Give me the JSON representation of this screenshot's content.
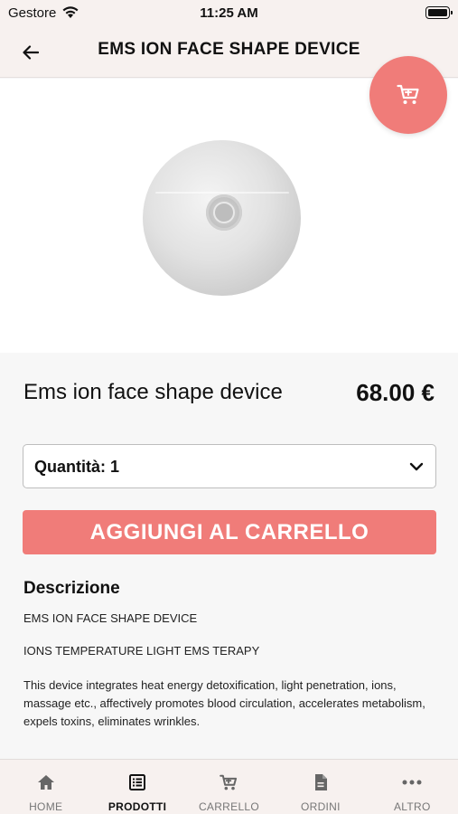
{
  "status_bar": {
    "carrier": "Gestore",
    "time": "11:25 AM"
  },
  "nav": {
    "title": "EMS ION FACE SHAPE DEVICE"
  },
  "product": {
    "name": "Ems ion face shape device",
    "price": "68.00 €"
  },
  "quantity": {
    "label": "Quantità: 1"
  },
  "add_to_cart": {
    "label": "AGGIUNGI AL CARRELLO"
  },
  "description": {
    "heading": "Descrizione",
    "line1": "EMS ION FACE SHAPE DEVICE",
    "line2": "IONS TEMPERATURE LIGHT EMS TERAPY",
    "paragraph": "This device integrates heat energy detoxification, light penetration, ions, massage etc., affectively promotes blood circulation, accelerates metabolism, expels toxins, eliminates wrinkles."
  },
  "tabs": [
    {
      "label": "HOME",
      "icon": "home-icon"
    },
    {
      "label": "PRODOTTI",
      "icon": "list-icon"
    },
    {
      "label": "CARRELLO",
      "icon": "cart-icon"
    },
    {
      "label": "ORDINI",
      "icon": "document-icon"
    },
    {
      "label": "ALTRO",
      "icon": "more-icon"
    }
  ],
  "active_tab": "PRODOTTI",
  "colors": {
    "accent": "#f07c79",
    "header_bg": "#f7f1ef"
  }
}
